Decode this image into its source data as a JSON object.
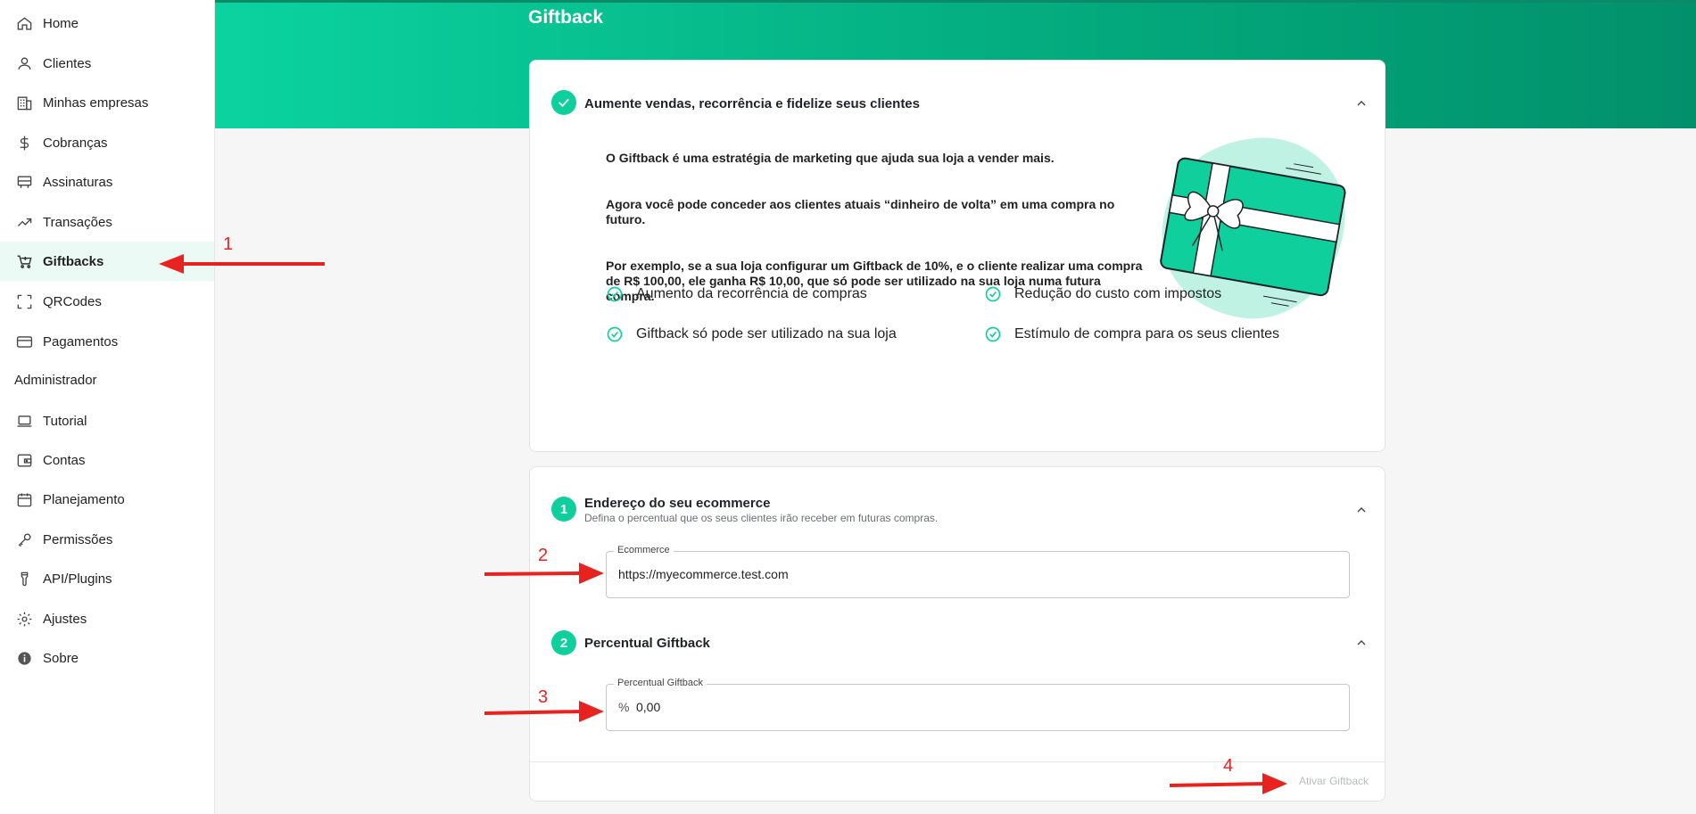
{
  "sidebar": {
    "items": [
      {
        "label": "Home",
        "icon": "home-icon"
      },
      {
        "label": "Clientes",
        "icon": "user-icon"
      },
      {
        "label": "Minhas empresas",
        "icon": "building-icon"
      },
      {
        "label": "Cobranças",
        "icon": "dollar-icon"
      },
      {
        "label": "Assinaturas",
        "icon": "subscription-icon"
      },
      {
        "label": "Transações",
        "icon": "trending-icon"
      },
      {
        "label": "Giftbacks",
        "icon": "cart-icon"
      },
      {
        "label": "QRCodes",
        "icon": "scan-icon"
      },
      {
        "label": "Pagamentos",
        "icon": "card-icon"
      }
    ],
    "admin_label": "Administrador",
    "admin_items": [
      {
        "label": "Tutorial",
        "icon": "laptop-icon"
      },
      {
        "label": "Contas",
        "icon": "wallet-icon"
      },
      {
        "label": "Planejamento",
        "icon": "calendar-icon"
      },
      {
        "label": "Permissões",
        "icon": "key-icon"
      },
      {
        "label": "API/Plugins",
        "icon": "plug-icon"
      },
      {
        "label": "Ajustes",
        "icon": "gear-icon"
      },
      {
        "label": "Sobre",
        "icon": "info-icon"
      }
    ],
    "active": "Giftbacks"
  },
  "header": {
    "title": "Giftback"
  },
  "intro": {
    "title": "Aumente vendas, recorrência e fidelize seus clientes",
    "paragraphs": [
      "O Giftback é uma estratégia de marketing que ajuda sua loja a vender mais.",
      "Agora você pode conceder aos clientes atuais “dinheiro de volta” em uma compra no futuro.",
      "Por exemplo, se a sua loja configurar um Giftback de 10%, e o cliente realizar uma compra de R$ 100,00, ele ganha R$ 10,00, que só pode ser utilizado na sua loja numa futura compra."
    ],
    "benefits": [
      "Aumento da recorrência de compras",
      "Redução do custo com impostos",
      "Giftback só pode ser utilizado na sua loja",
      "Estímulo de compra para os seus clientes"
    ]
  },
  "config": {
    "step1": {
      "number": "1",
      "title": "Endereço do seu ecommerce",
      "subtitle": "Defina o percentual que os seus clientes irão receber em futuras compras.",
      "field_label": "Ecommerce",
      "field_value": "https://myecommerce.test.com"
    },
    "step2": {
      "number": "2",
      "title": "Percentual Giftback",
      "field_label": "Percentual Giftback",
      "field_prefix": "%",
      "field_value": "0,00"
    },
    "activate_label": "Ativar Giftback"
  },
  "annotations": [
    "1",
    "2",
    "3",
    "4"
  ],
  "colors": {
    "accent": "#0fd09c",
    "annotation": "#e8231f"
  }
}
